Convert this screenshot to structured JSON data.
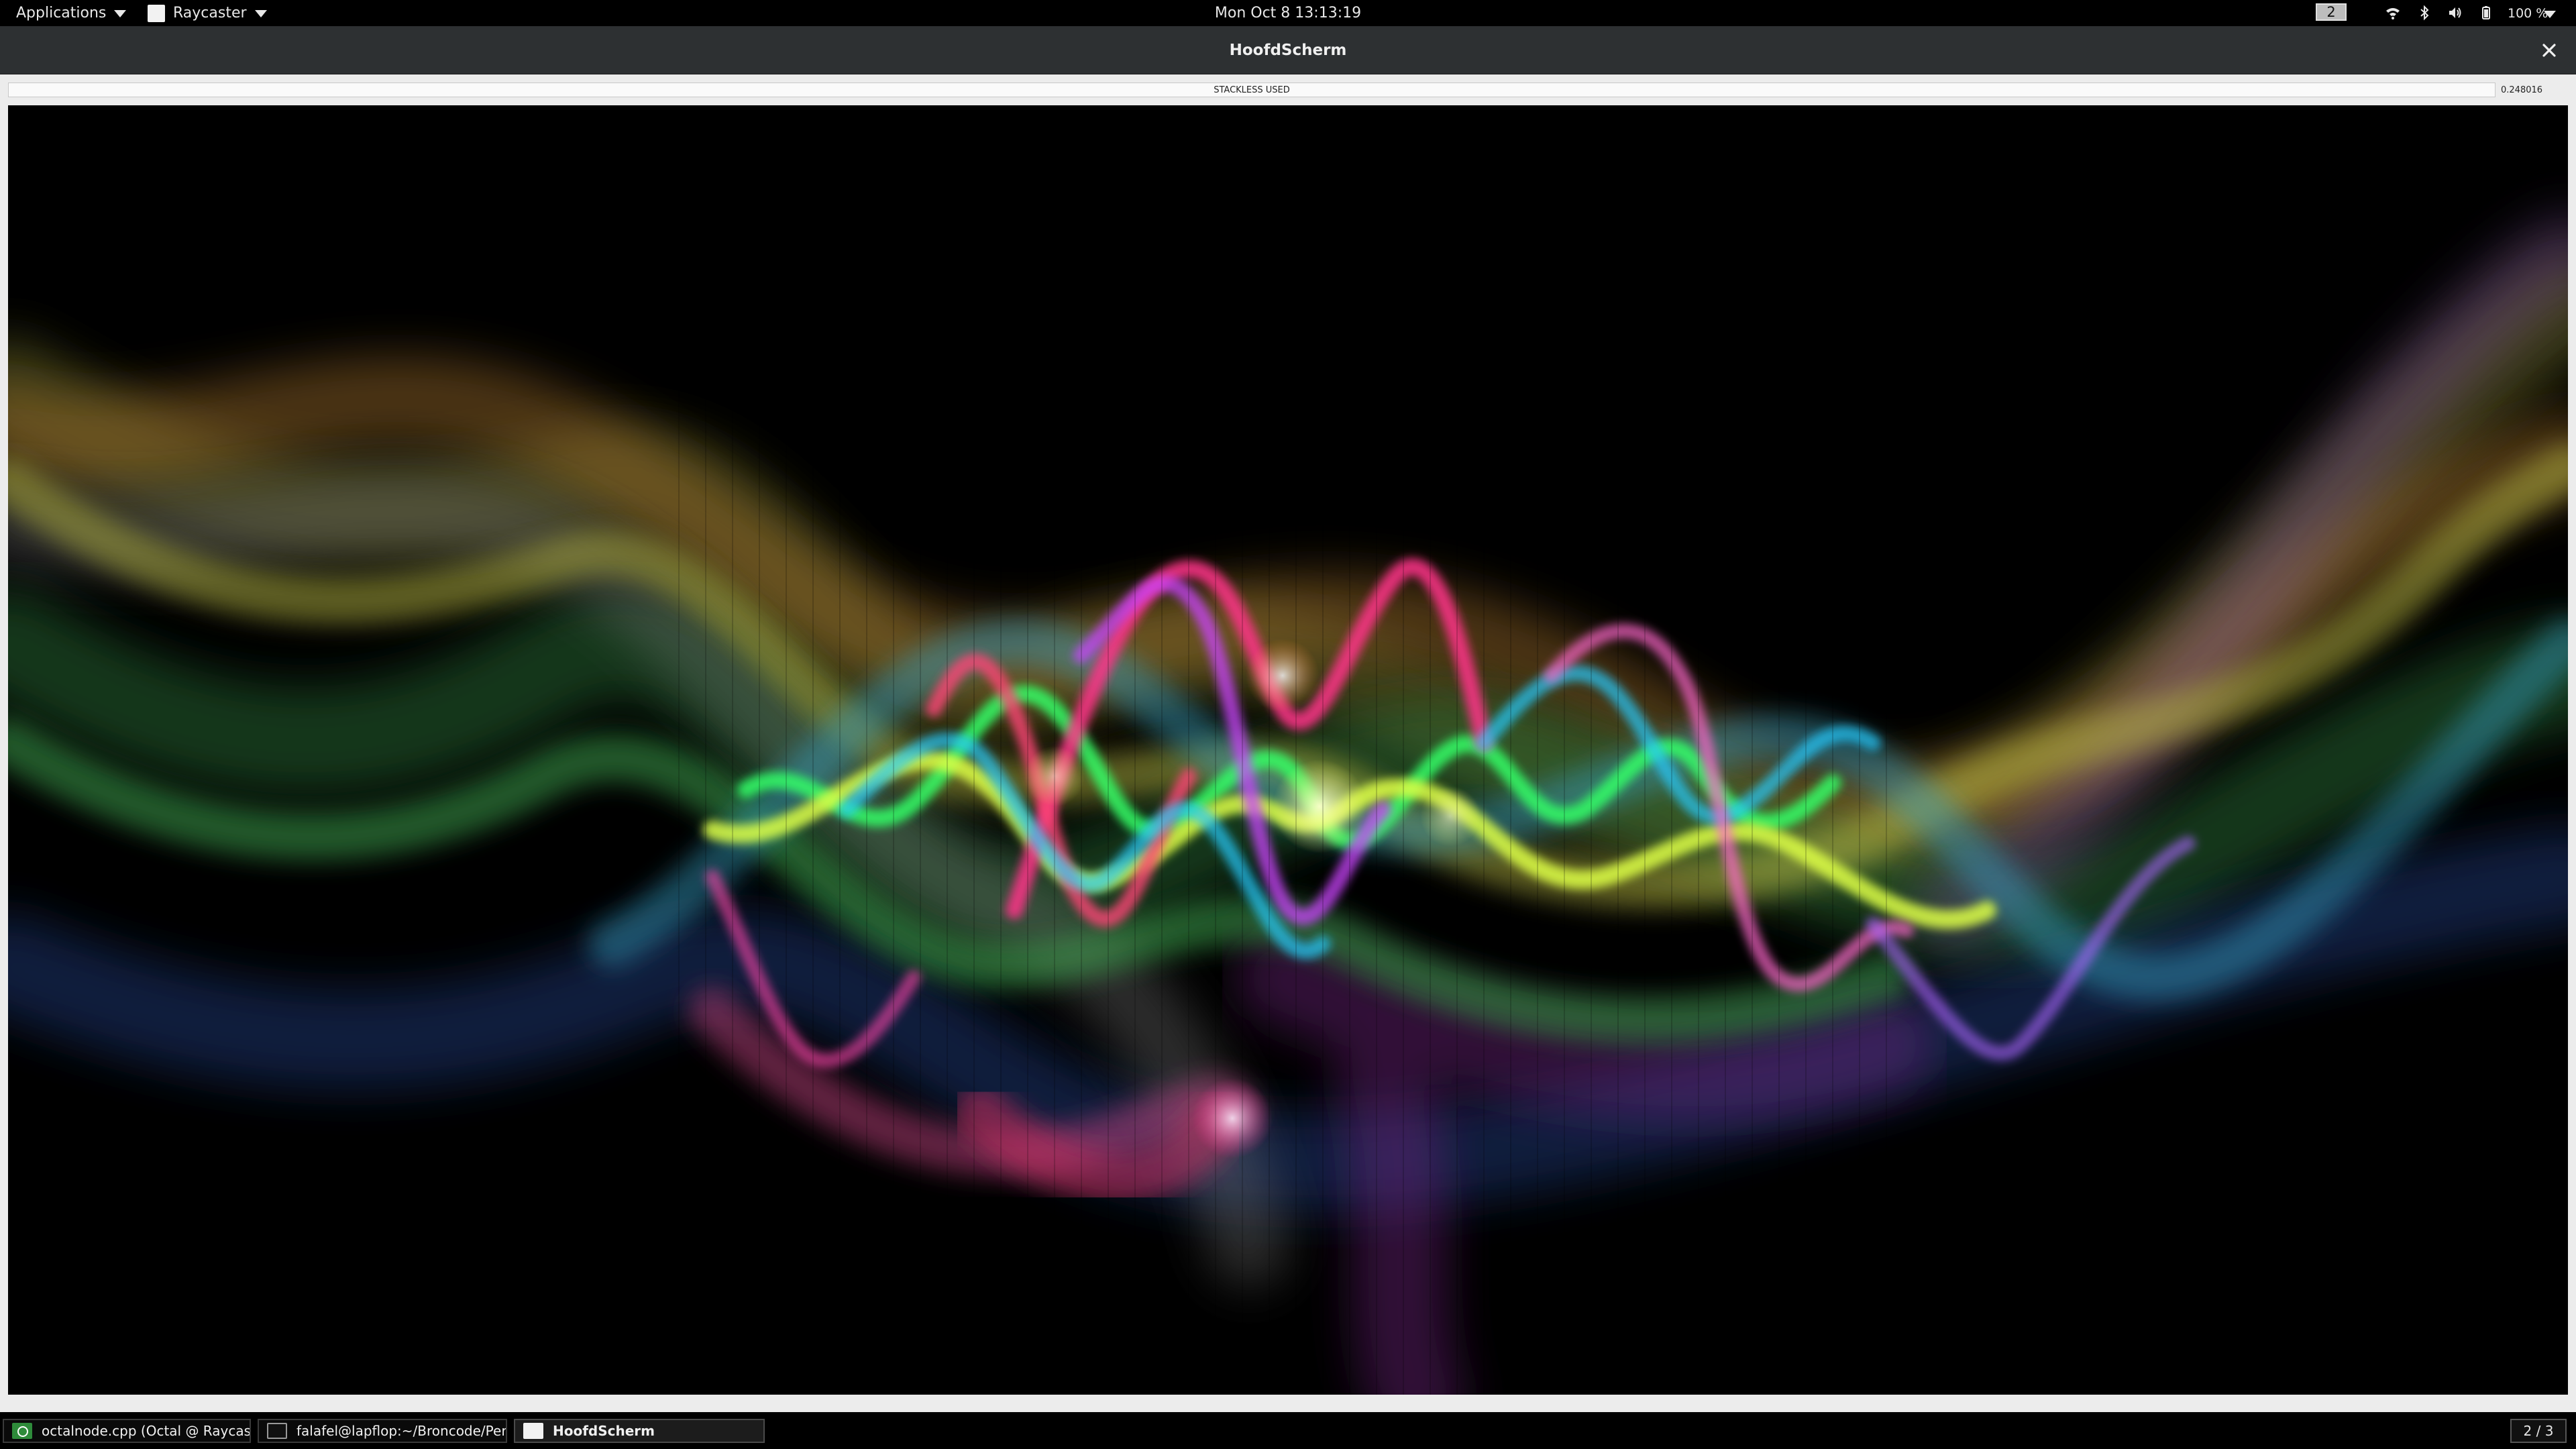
{
  "top_panel": {
    "applications_label": "Applications",
    "raycaster_label": "Raycaster",
    "clock": "Mon Oct 8  13:13:19",
    "workspace_number": "2",
    "battery_label": "100 %",
    "icons": [
      "wifi-icon",
      "bluetooth-icon",
      "volume-icon",
      "battery-icon",
      "chevron-down-icon"
    ]
  },
  "window": {
    "title": "HoofdScherm",
    "close_glyph": "✕",
    "status_text": "STACKLESS USED",
    "timing_value": "0.248016"
  },
  "taskbar": {
    "items": [
      {
        "label": "octalnode.cpp (Octal @ Raycaste...",
        "icon": "qt-creator-icon"
      },
      {
        "label": "falafel@lapflop:~/Broncode/Per...",
        "icon": "terminal-icon"
      },
      {
        "label": "HoofdScherm",
        "icon": "window-icon"
      }
    ],
    "workspace_pager": "2 / 3"
  }
}
